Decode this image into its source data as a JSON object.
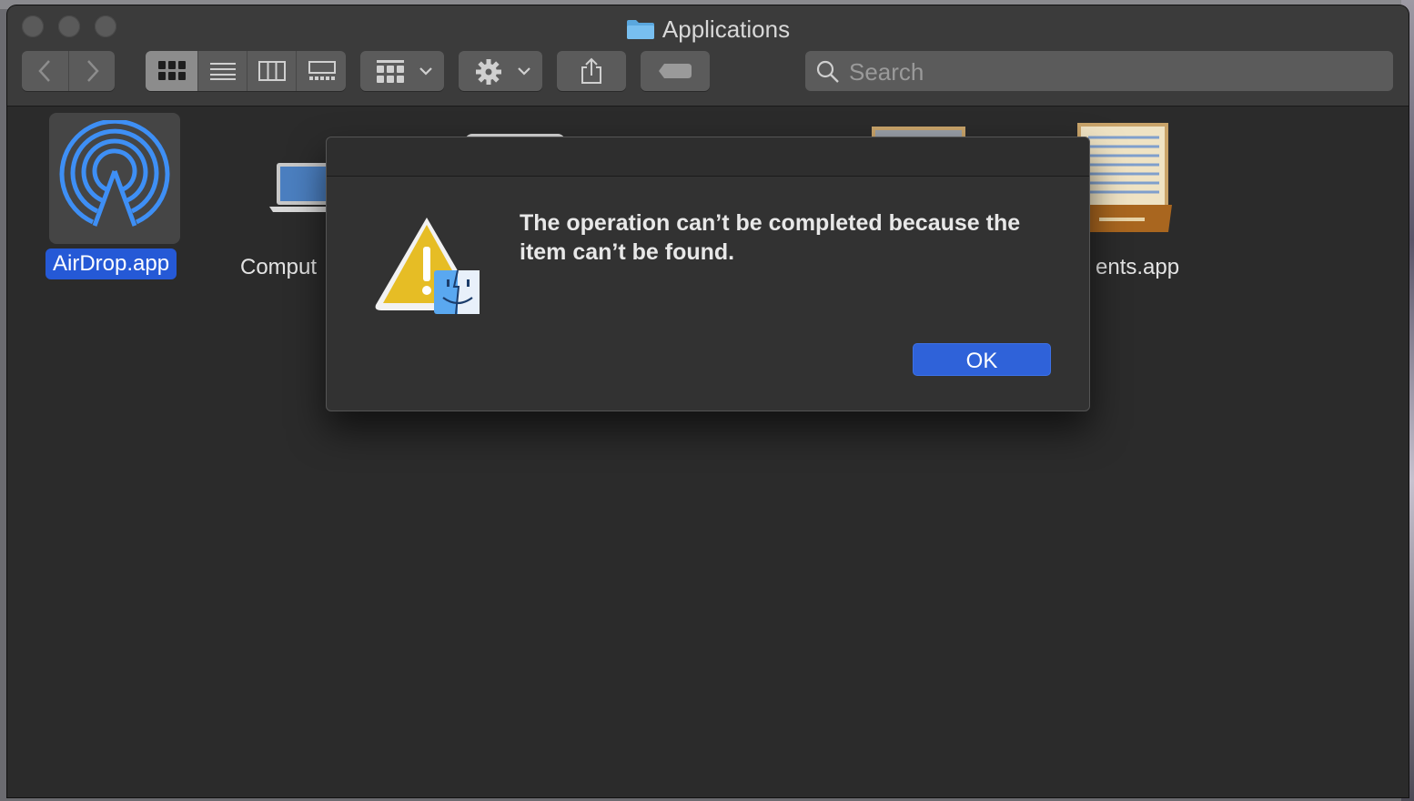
{
  "window": {
    "title": "Applications",
    "toolbar": {
      "back_icon": "chevron-left-icon",
      "forward_icon": "chevron-right-icon",
      "views": [
        "icon-view",
        "list-view",
        "column-view",
        "gallery-view"
      ],
      "active_view": "icon-view",
      "group_icon": "group-grid-icon",
      "action_icon": "gear-icon",
      "share_icon": "share-icon",
      "tag_icon": "tag-icon"
    },
    "search": {
      "placeholder": "Search",
      "value": ""
    }
  },
  "files": [
    {
      "label": "AirDrop.app",
      "selected": true,
      "icon": "airdrop-icon"
    },
    {
      "label": "Comput",
      "selected": false,
      "icon": "laptop-icon"
    },
    {
      "label": "ents.app",
      "selected": false,
      "icon": "documents-drawer-icon"
    }
  ],
  "dialog": {
    "message": "The operation can’t be completed because the item can’t be found.",
    "ok_label": "OK",
    "icon": "warning-finder-icon"
  },
  "colors": {
    "accent": "#2f62d9",
    "selection": "#2559d6",
    "background": "#2b2b2b"
  }
}
